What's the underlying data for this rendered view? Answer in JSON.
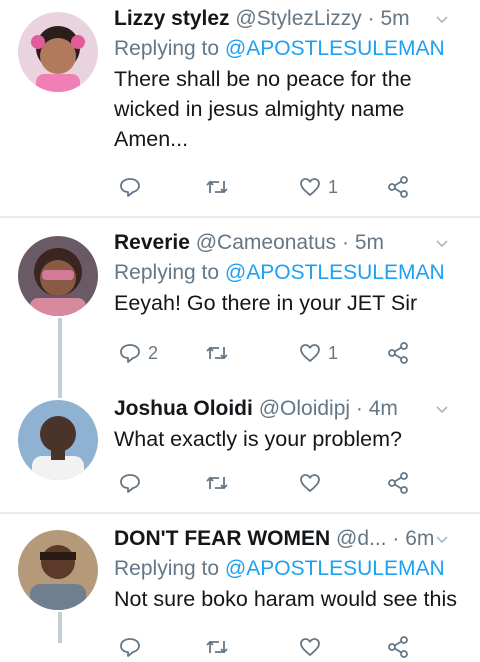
{
  "tweets": [
    {
      "name": "Lizzy stylez",
      "handle": "@StylezLizzy",
      "dot": "·",
      "time": "5m",
      "replying_label": "Replying to",
      "replying_to": "@APOSTLESULEMAN",
      "text_lines": [
        "There shall be no peace for the",
        "wicked in jesus almighty name",
        "Amen..."
      ],
      "reply_count": "",
      "retweet_count": "",
      "like_count": "1",
      "avatar_colors": {
        "bg": "#d8a7c4",
        "skin": "#b27a5c"
      }
    },
    {
      "name": "Reverie",
      "handle": "@Cameonatus",
      "dot": "·",
      "time": "5m",
      "replying_label": "Replying to",
      "replying_to": "@APOSTLESULEMAN",
      "text_lines": [
        "Eeyah! Go there in your JET Sir"
      ],
      "reply_count": "2",
      "retweet_count": "",
      "like_count": "1",
      "avatar_colors": {
        "bg": "#c97c8c",
        "skin": "#8a5a45"
      }
    },
    {
      "name": "Joshua Oloidi",
      "handle": "@Oloidipj",
      "dot": "·",
      "time": "4m",
      "text_lines": [
        "What exactly is your problem?"
      ],
      "reply_count": "",
      "retweet_count": "",
      "like_count": "",
      "avatar_colors": {
        "bg": "#7fa3c7",
        "skin": "#4a3328"
      }
    },
    {
      "name": "DON'T FEAR WOMEN",
      "handle": "@d...",
      "dot": "·",
      "time": "6m",
      "replying_label": "Replying to",
      "replying_to": "@APOSTLESULEMAN",
      "text_lines": [
        "Not sure boko haram would see this"
      ],
      "reply_count": "",
      "retweet_count": "",
      "like_count": "",
      "avatar_colors": {
        "bg": "#a88a6a",
        "skin": "#5b3a2a"
      }
    }
  ],
  "colors": {
    "accent": "#1da1f2",
    "muted": "#657786",
    "text": "#14171a",
    "divider": "#e6ecf0"
  },
  "icons": [
    "reply-icon",
    "retweet-icon",
    "like-icon",
    "share-icon",
    "chevron-down-icon"
  ]
}
